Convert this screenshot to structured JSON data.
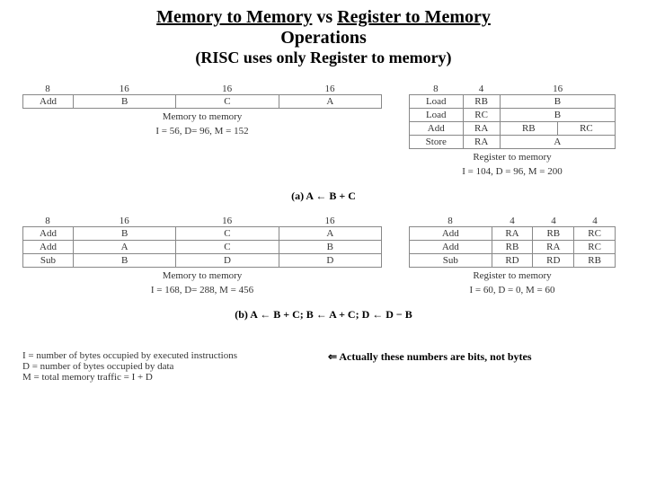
{
  "title": {
    "part1": "Memory to Memory",
    "vs": "vs",
    "part2": "Register to Memory",
    "line2": "Operations",
    "note": "(RISC uses only Register to memory)"
  },
  "sectionA": {
    "left": {
      "widths": [
        "8",
        "16",
        "16",
        "16"
      ],
      "rows": [
        [
          "Add",
          "B",
          "C",
          "A"
        ]
      ],
      "caption": "Memory to memory",
      "stats": "I =   56, D= 96, M = 152"
    },
    "right": {
      "widths": [
        "8",
        "4",
        "16"
      ],
      "rows": [
        [
          "Load",
          "RB",
          "B"
        ],
        [
          "Load",
          "RC",
          "B"
        ],
        [
          "Add",
          "RA",
          "RB",
          "RC"
        ],
        [
          "Store",
          "RA",
          "A"
        ]
      ],
      "caption": "Register to memory",
      "stats": "I = 104, D = 96, M = 200"
    },
    "eq": "(a) A ← B + C"
  },
  "sectionB": {
    "left": {
      "widths": [
        "8",
        "16",
        "16",
        "16"
      ],
      "rows": [
        [
          "Add",
          "B",
          "C",
          "A"
        ],
        [
          "Add",
          "A",
          "C",
          "B"
        ],
        [
          "Sub",
          "B",
          "D",
          "D"
        ]
      ],
      "caption": "Memory to memory",
      "stats": "I =  168, D= 288, M = 456"
    },
    "right": {
      "widths": [
        "8",
        "4",
        "4",
        "4"
      ],
      "rows": [
        [
          "Add",
          "RA",
          "RB",
          "RC"
        ],
        [
          "Add",
          "RB",
          "RA",
          "RC"
        ],
        [
          "Sub",
          "RD",
          "RD",
          "RB"
        ]
      ],
      "caption": "Register to memory",
      "stats": "I = 60, D = 0, M = 60"
    },
    "eq": "(b) A ← B + C; B ← A + C; D ← D − B"
  },
  "legend": {
    "l1": "I = number of bytes occupied by executed instructions",
    "l2": "D = number of bytes occupied by data",
    "l3": "M = total memory traffic = I + D"
  },
  "annotation": "⇐ Actually these numbers are bits, not bytes"
}
